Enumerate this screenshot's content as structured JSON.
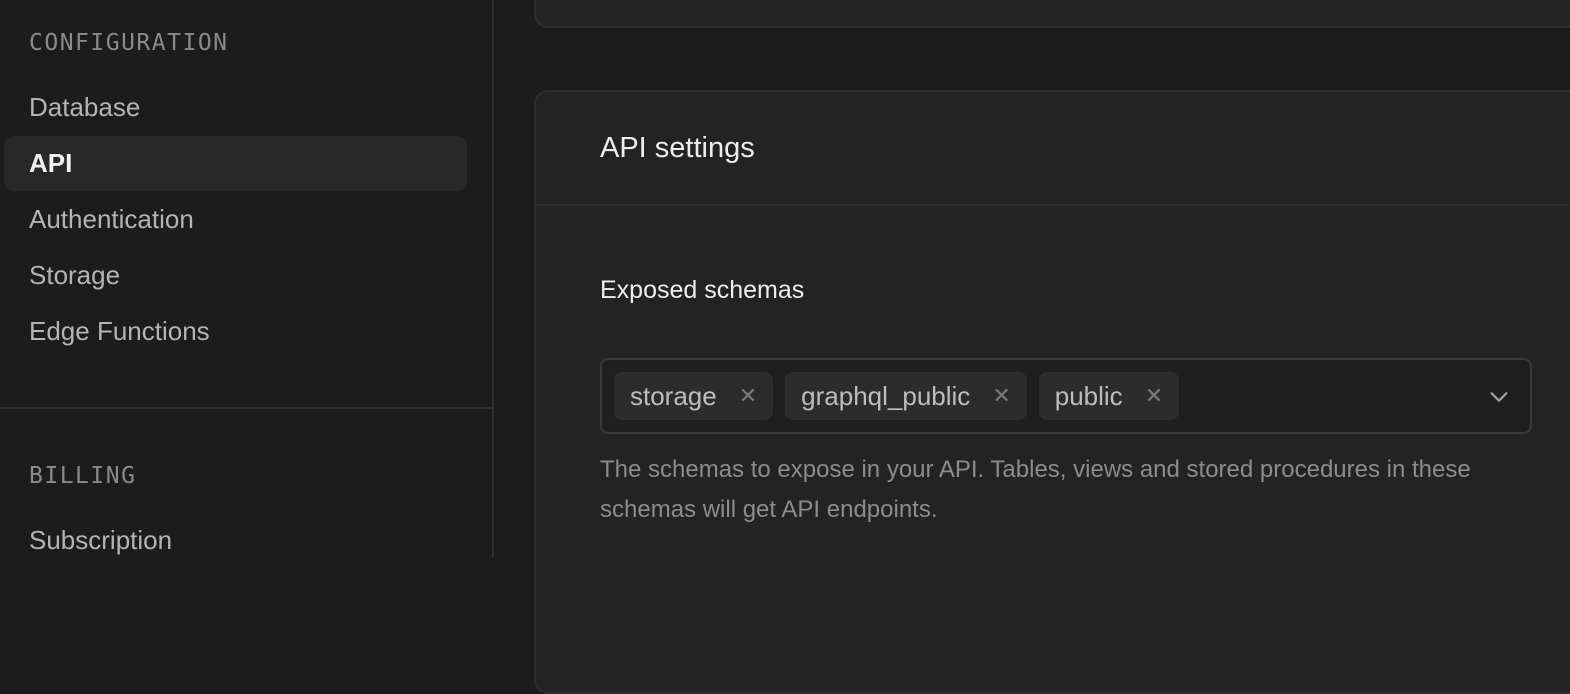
{
  "sidebar": {
    "sections": [
      {
        "title": "CONFIGURATION",
        "items": [
          {
            "label": "Database",
            "active": false
          },
          {
            "label": "API",
            "active": true
          },
          {
            "label": "Authentication",
            "active": false
          },
          {
            "label": "Storage",
            "active": false
          },
          {
            "label": "Edge Functions",
            "active": false
          }
        ]
      },
      {
        "title": "BILLING",
        "items": [
          {
            "label": "Subscription",
            "active": false
          }
        ]
      }
    ]
  },
  "main": {
    "card": {
      "title": "API settings",
      "exposed_schemas": {
        "label": "Exposed schemas",
        "selected": [
          "storage",
          "graphql_public",
          "public"
        ],
        "remove_icon": "close-icon",
        "dropdown_icon": "chevron-down-icon",
        "help_text": "The schemas to expose in your API. Tables, views and stored procedures in these schemas will get API endpoints."
      }
    }
  }
}
